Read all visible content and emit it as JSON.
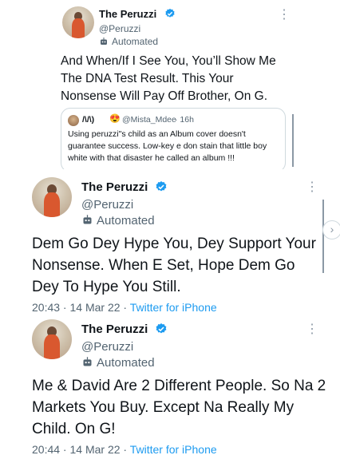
{
  "tweets": [
    {
      "name": "The Peruzzi",
      "handle": "@Peruzzi",
      "automated": "Automated",
      "text": "And When/If I See You, You’ll Show Me The DNA Test Result. This Your Nonsense Will Pay Off Brother, On G.",
      "quote": {
        "author": "/\\/\\)",
        "emoji": "😍",
        "handle": "@Mista_Mdee",
        "time": "· 16h",
        "text": "Using peruzzi\"s child as an Album cover doesn't guarantee success. Low-key e don stain that little boy white with that disaster he called an album !!!"
      }
    },
    {
      "name": "The Peruzzi",
      "handle": "@Peruzzi",
      "automated": "Automated",
      "text": "Dem Go Dey Hype You, Dey Support Your Nonsense. When E Set, Hope Dem Go Dey To Hype You Still.",
      "time": "20:43 · 14 Mar 22 · ",
      "source": "Twitter for iPhone"
    },
    {
      "name": "The Peruzzi",
      "handle": "@Peruzzi",
      "automated": "Automated",
      "text": "Me & David Are 2 Different People. So Na 2 Markets You Buy. Except Na Really My Child. On G!",
      "time": "20:44 · 14 Mar 22 · ",
      "source": "Twitter for iPhone"
    }
  ],
  "more_icon": "⋮",
  "scroll_icon": "›",
  "colors": {
    "verified": "#1d9bf0",
    "link": "#1d9bf0",
    "secondary": "#536471"
  }
}
